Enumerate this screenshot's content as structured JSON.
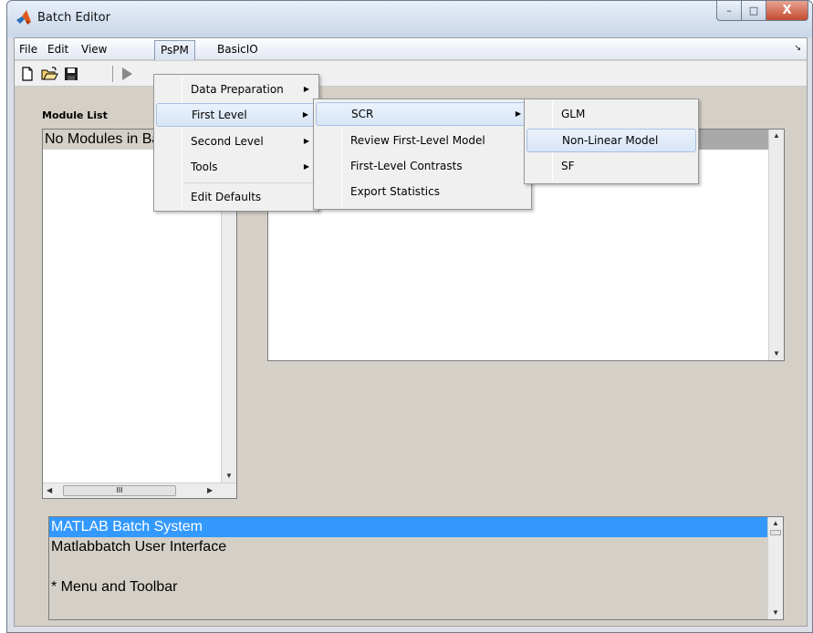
{
  "window": {
    "title": "Batch Editor",
    "controls": {
      "minimize": "–",
      "maximize": "□",
      "close": "X"
    }
  },
  "menubar": {
    "items": [
      "File",
      "Edit",
      "View",
      "PsPM",
      "BasicIO"
    ],
    "overflow_arrow": "↘"
  },
  "toolbar": {
    "icons": [
      "new-file-icon",
      "open-folder-icon",
      "save-icon",
      "run-icon"
    ]
  },
  "module_list": {
    "label": "Module List",
    "first_item": "No Modules in Batch",
    "hscroll_grip": "III"
  },
  "help": {
    "lines": [
      "MATLAB Batch System",
      "Matlabbatch User Interface",
      "",
      "* Menu and Toolbar"
    ]
  },
  "menus": {
    "pspm": {
      "items": [
        "Data Preparation",
        "First Level",
        "Second Level",
        "Tools",
        "Edit Defaults"
      ]
    },
    "first_level": {
      "items": [
        "SCR",
        "Review First-Level Model",
        "First-Level Contrasts",
        "Export Statistics"
      ]
    },
    "scr": {
      "items": [
        "GLM",
        "Non-Linear Model",
        "SF"
      ]
    }
  },
  "colors": {
    "selection": "#3399ff",
    "client_bg": "#d4d0c8",
    "menu_highlight": "#d8e6f7"
  }
}
